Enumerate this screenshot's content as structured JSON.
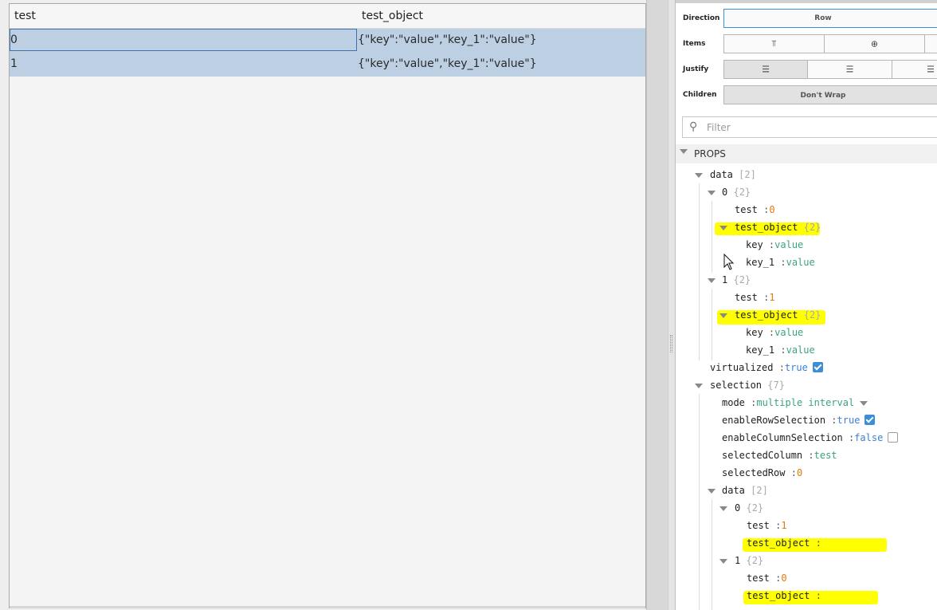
{
  "table": {
    "columns": [
      "test",
      "test_object"
    ],
    "rows": [
      {
        "test": "0",
        "test_object": "{\"key\":\"value\",\"key_1\":\"value\"}"
      },
      {
        "test": "1",
        "test_object": "{\"key\":\"value\",\"key_1\":\"value\"}"
      }
    ]
  },
  "layout_controls": {
    "direction_label": "Direction",
    "direction_value": "Row",
    "items_label": "Items",
    "justify_label": "Justify",
    "children_label": "Children",
    "children_value": "Don't Wrap"
  },
  "filter": {
    "placeholder": "Filter"
  },
  "props": {
    "section_title": "PROPS",
    "tree": {
      "data_key": "data",
      "data_count": "[2]",
      "item0_key": "0",
      "item0_count": "{2}",
      "item0_test_key": "test",
      "item0_test_val": "0",
      "item0_obj_key": "test_object",
      "item0_obj_count": "{2}",
      "item0_key_key": "key",
      "item0_key_val": "value",
      "item0_key1_key": "key_1",
      "item0_key1_val": "value",
      "item1_key": "1",
      "item1_count": "{2}",
      "item1_test_key": "test",
      "item1_test_val": "1",
      "item1_obj_key": "test_object",
      "item1_obj_count": "{2}",
      "item1_key_key": "key",
      "item1_key_val": "value",
      "item1_key1_key": "key_1",
      "item1_key1_val": "value",
      "virtualized_key": "virtualized",
      "virtualized_val": "true",
      "selection_key": "selection",
      "selection_count": "{7}",
      "mode_key": "mode",
      "mode_val": "multiple interval",
      "ers_key": "enableRowSelection",
      "ers_val": "true",
      "ecs_key": "enableColumnSelection",
      "ecs_val": "false",
      "selcol_key": "selectedColumn",
      "selcol_val": "test",
      "selrow_key": "selectedRow",
      "selrow_val": "0",
      "seldata_key": "data",
      "seldata_count": "[2]",
      "sd0_key": "0",
      "sd0_count": "{2}",
      "sd0_test_key": "test",
      "sd0_test_val": "1",
      "sd0_obj_key": "test_object",
      "sd1_key": "1",
      "sd1_count": "{2}",
      "sd1_test_key": "test",
      "sd1_test_val": "0",
      "sd1_obj_key": "test_object",
      "separator": ":"
    }
  },
  "colors": {
    "selection_row": "#bdd0e3",
    "highlight": "#ffff00",
    "number": "#e07a0c",
    "string": "#3aa57a",
    "boolean": "#3a7fd2"
  }
}
